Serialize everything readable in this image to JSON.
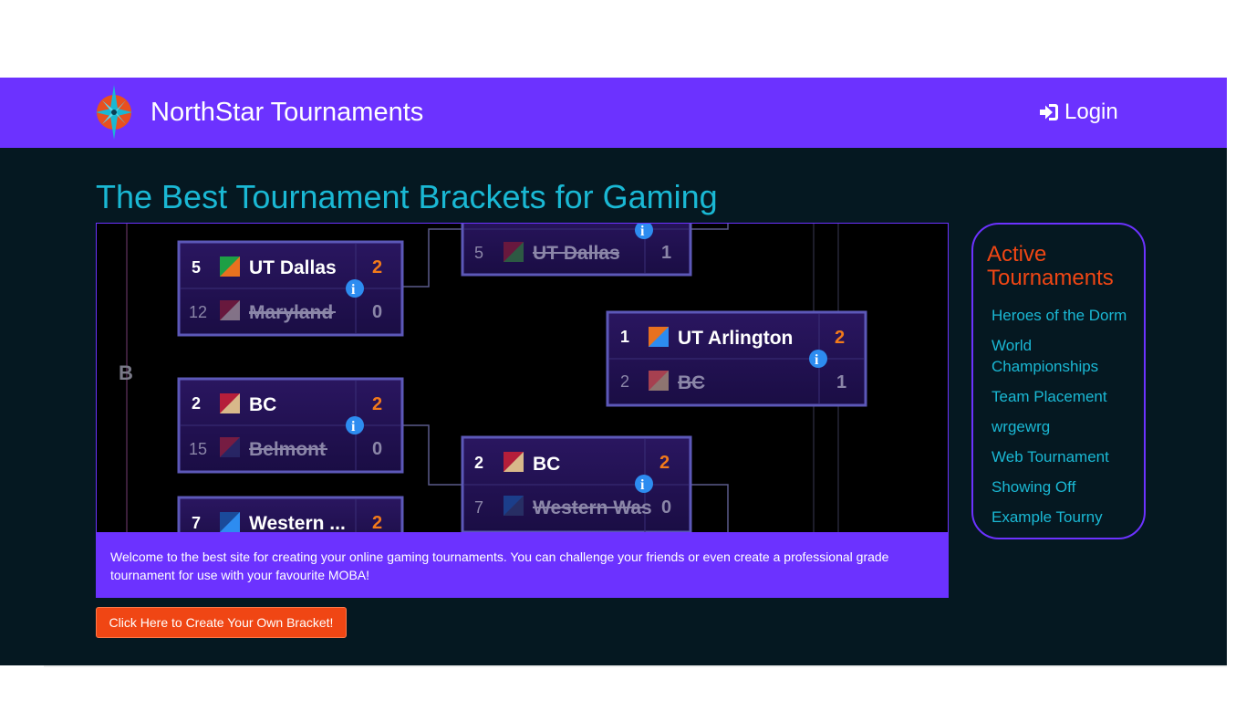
{
  "navbar": {
    "brand": "NorthStar Tournaments",
    "login_label": "Login",
    "login_icon": "sign-in-icon",
    "brand_icon": "compass-star-logo"
  },
  "main": {
    "title": "The Best Tournament Brackets for Gaming",
    "welcome_text": "Welcome to the best site for creating your online gaming tournaments. You can challenge your friends or even create a professional grade tournament for use with your favourite MOBA!",
    "create_button": "Click Here to Create Your Own Bracket!"
  },
  "bracket": {
    "group_label": "B",
    "matches": [
      {
        "top": {
          "seed": "5",
          "name": "UT Dallas",
          "score": "2"
        },
        "bottom": {
          "seed": "12",
          "name": "Maryland",
          "score": "0"
        }
      },
      {
        "top": {
          "seed": "2",
          "name": "BC",
          "score": "2"
        },
        "bottom": {
          "seed": "15",
          "name": "Belmont",
          "score": "0"
        }
      },
      {
        "top": {
          "seed": "7",
          "name": "Western ...",
          "score": "2"
        }
      },
      {
        "top": {
          "seed": "5",
          "name": "UT Dallas",
          "score": "1"
        }
      },
      {
        "top": {
          "seed": "2",
          "name": "BC",
          "score": "2"
        },
        "bottom": {
          "seed": "7",
          "name": "Western Was",
          "score": "0"
        }
      },
      {
        "top": {
          "seed": "1",
          "name": "UT Arlington",
          "score": "2"
        },
        "bottom": {
          "seed": "2",
          "name": "BC",
          "score": "1"
        }
      }
    ]
  },
  "sidebar": {
    "title": "Active Tournaments",
    "items": [
      "Heroes of the Dorm",
      "World Championships",
      "Team Placement",
      "wrgewrg",
      "Web Tournament",
      "Showing Off",
      "Example Tourny"
    ]
  },
  "colors": {
    "accent": "#6c32ff",
    "background": "#051821",
    "title": "#1ab8d4",
    "orange": "#f04614"
  }
}
